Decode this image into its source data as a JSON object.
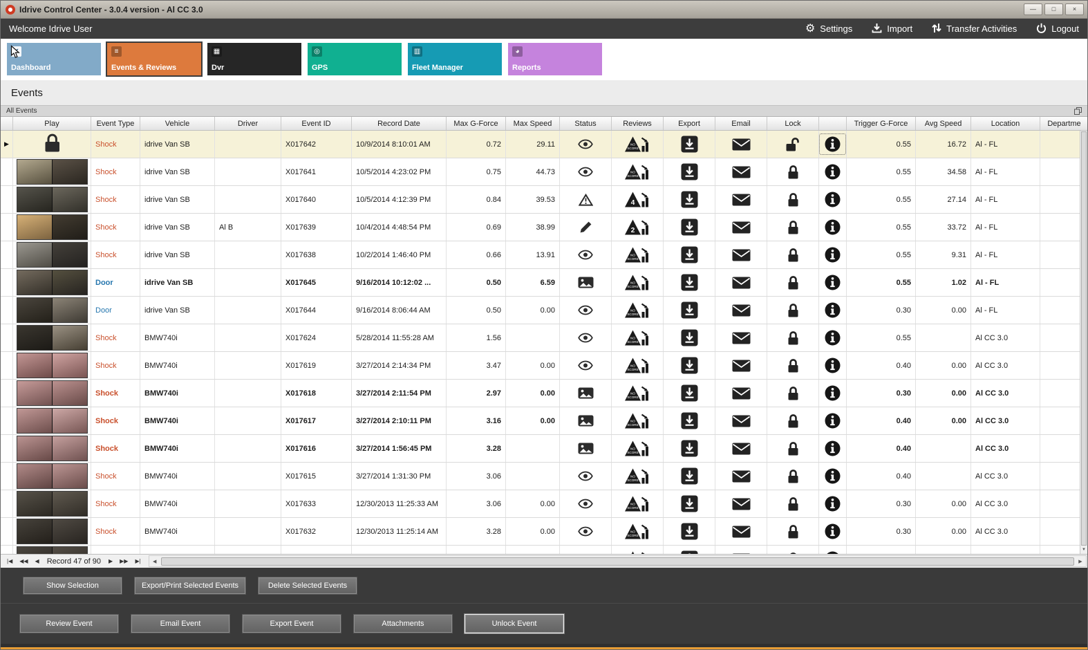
{
  "window": {
    "title": "Idrive Control Center - 3.0.4 version - Al CC 3.0",
    "controls": {
      "minimize": "—",
      "maximize": "□",
      "close": "×"
    }
  },
  "toolbar": {
    "welcome": "Welcome Idrive User",
    "actions": [
      {
        "label": "Settings",
        "icon": "gear-icon"
      },
      {
        "label": "Import",
        "icon": "import-icon"
      },
      {
        "label": "Transfer Activities",
        "icon": "transfer-icon"
      },
      {
        "label": "Logout",
        "icon": "power-icon"
      }
    ]
  },
  "tabs": [
    {
      "label": "Dashboard",
      "color": "#82aac8",
      "icon": "checkbox-icon",
      "selected": false
    },
    {
      "label": "Events & Reviews",
      "color": "#dd7a3d",
      "icon": "events-icon",
      "selected": true
    },
    {
      "label": "Dvr",
      "color": "#262626",
      "icon": "dvr-icon",
      "selected": false
    },
    {
      "label": "GPS",
      "color": "#10b091",
      "icon": "pin-icon",
      "selected": false
    },
    {
      "label": "Fleet Manager",
      "color": "#169bb4",
      "icon": "fleet-icon",
      "selected": false
    },
    {
      "label": "Reports",
      "color": "#c583dd",
      "icon": "pie-icon",
      "selected": false
    }
  ],
  "page": {
    "title": "Events",
    "group_header": "All Events"
  },
  "grid": {
    "selection_arrow": "▶",
    "columns": [
      "",
      "Play",
      "Event Type",
      "Vehicle",
      "Driver",
      "Event ID",
      "Record Date",
      "Max G-Force",
      "Max Speed",
      "Status",
      "Reviews",
      "Export",
      "Email",
      "Lock",
      "",
      "Trigger G-Force",
      "Avg Speed",
      "Location",
      "Departme"
    ],
    "rows": [
      {
        "selected": true,
        "bold": false,
        "play": "lock",
        "event_type": "Shock",
        "vehicle": "idrive Van SB",
        "driver": "",
        "event_id": "X017642",
        "record_date": "10/9/2014 8:10:01 AM",
        "max_g_force": "0.72",
        "max_speed": "29.11",
        "status": "eye",
        "review": "NO SCORE",
        "lock": "unlocked",
        "trigger_g_force": "0.55",
        "avg_speed": "16.72",
        "location": "Al - FL",
        "thumb": []
      },
      {
        "selected": false,
        "bold": false,
        "play": "thumb",
        "event_type": "Shock",
        "vehicle": "idrive Van SB",
        "driver": "",
        "event_id": "X017641",
        "record_date": "10/5/2014 4:23:02 PM",
        "max_g_force": "0.75",
        "max_speed": "44.73",
        "status": "eye",
        "review": "NO SCORE",
        "lock": "locked",
        "trigger_g_force": "0.55",
        "avg_speed": "34.58",
        "location": "Al - FL",
        "thumb": [
          "#b3a98f",
          "#57503f",
          "#5a5146",
          "#2a2620"
        ]
      },
      {
        "selected": false,
        "bold": false,
        "play": "thumb",
        "event_type": "Shock",
        "vehicle": "idrive Van SB",
        "driver": "",
        "event_id": "X017640",
        "record_date": "10/5/2014 4:12:39 PM",
        "max_g_force": "0.84",
        "max_speed": "39.53",
        "status": "warning",
        "review": "4",
        "lock": "locked",
        "trigger_g_force": "0.55",
        "avg_speed": "27.14",
        "location": "Al - FL",
        "thumb": [
          "#55534b",
          "#26251f",
          "#6b675c",
          "#32302a"
        ]
      },
      {
        "selected": false,
        "bold": false,
        "play": "thumb",
        "event_type": "Shock",
        "vehicle": "idrive Van SB",
        "driver": "Al B",
        "event_id": "X017639",
        "record_date": "10/4/2014 4:48:54 PM",
        "max_g_force": "0.69",
        "max_speed": "38.99",
        "status": "pencil",
        "review": "2",
        "lock": "locked",
        "trigger_g_force": "0.55",
        "avg_speed": "33.72",
        "location": "Al - FL",
        "thumb": [
          "#d7b177",
          "#7c6340",
          "#433c31",
          "#201d18"
        ]
      },
      {
        "selected": false,
        "bold": false,
        "play": "thumb",
        "event_type": "Shock",
        "vehicle": "idrive Van SB",
        "driver": "",
        "event_id": "X017638",
        "record_date": "10/2/2014 1:46:40 PM",
        "max_g_force": "0.66",
        "max_speed": "13.91",
        "status": "eye",
        "review": "NO SCORE",
        "lock": "locked",
        "trigger_g_force": "0.55",
        "avg_speed": "9.31",
        "location": "Al - FL",
        "thumb": [
          "#9b9890",
          "#4f4c45",
          "#44403a",
          "#242220"
        ]
      },
      {
        "selected": false,
        "bold": true,
        "play": "thumb",
        "event_type": "Door",
        "vehicle": "idrive Van SB",
        "driver": "",
        "event_id": "X017645",
        "record_date": "9/16/2014 10:12:02 ...",
        "max_g_force": "0.50",
        "max_speed": "6.59",
        "status": "image",
        "review": "NO SCORE",
        "lock": "locked",
        "trigger_g_force": "0.55",
        "avg_speed": "1.02",
        "location": "Al - FL",
        "thumb": [
          "#746b5e",
          "#332f28",
          "#55503f",
          "#262320"
        ]
      },
      {
        "selected": false,
        "bold": false,
        "play": "thumb",
        "event_type": "Door",
        "vehicle": "idrive Van SB",
        "driver": "",
        "event_id": "X017644",
        "record_date": "9/16/2014 8:06:44 AM",
        "max_g_force": "0.50",
        "max_speed": "0.00",
        "status": "eye",
        "review": "NO SCORE",
        "lock": "locked",
        "trigger_g_force": "0.30",
        "avg_speed": "0.00",
        "location": "Al - FL",
        "thumb": [
          "#4a453d",
          "#232019",
          "#8c8477",
          "#3e3a33"
        ]
      },
      {
        "selected": false,
        "bold": false,
        "play": "thumb",
        "event_type": "Shock",
        "vehicle": "BMW740i",
        "driver": "",
        "event_id": "X017624",
        "record_date": "5/28/2014 11:55:28 AM",
        "max_g_force": "1.56",
        "max_speed": "",
        "status": "eye",
        "review": "NO SCORE",
        "lock": "locked",
        "trigger_g_force": "0.55",
        "avg_speed": "",
        "location": "Al CC 3.0",
        "thumb": [
          "#3a362f",
          "#1c1a16",
          "#9a9183",
          "#463f33"
        ]
      },
      {
        "selected": false,
        "bold": false,
        "play": "thumb",
        "event_type": "Shock",
        "vehicle": "BMW740i",
        "driver": "",
        "event_id": "X017619",
        "record_date": "3/27/2014 2:14:34 PM",
        "max_g_force": "3.47",
        "max_speed": "0.00",
        "status": "eye",
        "review": "NO SCORE",
        "lock": "locked",
        "trigger_g_force": "0.40",
        "avg_speed": "0.00",
        "location": "Al CC 3.0",
        "thumb": [
          "#c49795",
          "#6e4b49",
          "#d0a4a2",
          "#7a5553"
        ]
      },
      {
        "selected": false,
        "bold": true,
        "play": "thumb",
        "event_type": "Shock",
        "vehicle": "BMW740i",
        "driver": "",
        "event_id": "X017618",
        "record_date": "3/27/2014 2:11:54 PM",
        "max_g_force": "2.97",
        "max_speed": "0.00",
        "status": "image",
        "review": "NO SCORE",
        "lock": "locked",
        "trigger_g_force": "0.30",
        "avg_speed": "0.00",
        "location": "Al CC 3.0",
        "thumb": [
          "#c79c9a",
          "#715150",
          "#bb918f",
          "#684a48"
        ]
      },
      {
        "selected": false,
        "bold": true,
        "play": "thumb",
        "event_type": "Shock",
        "vehicle": "BMW740i",
        "driver": "",
        "event_id": "X017617",
        "record_date": "3/27/2014 2:10:11 PM",
        "max_g_force": "3.16",
        "max_speed": "0.00",
        "status": "image",
        "review": "NO SCORE",
        "lock": "locked",
        "trigger_g_force": "0.40",
        "avg_speed": "0.00",
        "location": "Al CC 3.0",
        "thumb": [
          "#c19896",
          "#6d4e4c",
          "#cda8a6",
          "#775654"
        ]
      },
      {
        "selected": false,
        "bold": true,
        "play": "thumb",
        "event_type": "Shock",
        "vehicle": "BMW740i",
        "driver": "",
        "event_id": "X017616",
        "record_date": "3/27/2014 1:56:45 PM",
        "max_g_force": "3.28",
        "max_speed": "",
        "status": "image",
        "review": "NO SCORE",
        "lock": "locked",
        "trigger_g_force": "0.40",
        "avg_speed": "",
        "location": "Al CC 3.0",
        "thumb": [
          "#bb9492",
          "#674947",
          "#c5a09e",
          "#705251"
        ]
      },
      {
        "selected": false,
        "bold": false,
        "play": "thumb",
        "event_type": "Shock",
        "vehicle": "BMW740i",
        "driver": "",
        "event_id": "X017615",
        "record_date": "3/27/2014 1:31:30 PM",
        "max_g_force": "3.06",
        "max_speed": "",
        "status": "eye",
        "review": "NO SCORE",
        "lock": "locked",
        "trigger_g_force": "0.40",
        "avg_speed": "",
        "location": "Al CC 3.0",
        "thumb": [
          "#b28b89",
          "#5f4442",
          "#bc9694",
          "#6a4c4a"
        ]
      },
      {
        "selected": false,
        "bold": false,
        "play": "thumb",
        "event_type": "Shock",
        "vehicle": "BMW740i",
        "driver": "",
        "event_id": "X017633",
        "record_date": "12/30/2013 11:25:33 AM",
        "max_g_force": "3.06",
        "max_speed": "0.00",
        "status": "eye",
        "review": "NO SCORE",
        "lock": "locked",
        "trigger_g_force": "0.30",
        "avg_speed": "0.00",
        "location": "Al CC 3.0",
        "thumb": [
          "#565148",
          "#2b2822",
          "#5f594f",
          "#312d27"
        ]
      },
      {
        "selected": false,
        "bold": false,
        "play": "thumb",
        "event_type": "Shock",
        "vehicle": "BMW740i",
        "driver": "",
        "event_id": "X017632",
        "record_date": "12/30/2013 11:25:14 AM",
        "max_g_force": "3.28",
        "max_speed": "0.00",
        "status": "eye",
        "review": "NO SCORE",
        "lock": "locked",
        "trigger_g_force": "0.30",
        "avg_speed": "0.00",
        "location": "Al CC 3.0",
        "thumb": [
          "#46423b",
          "#231f1a",
          "#4f4a43",
          "#282420"
        ]
      },
      {
        "selected": false,
        "bold": false,
        "play": "thumb",
        "event_type": "",
        "vehicle": "",
        "driver": "",
        "event_id": "",
        "record_date": "",
        "max_g_force": "",
        "max_speed": "",
        "status": "eye",
        "review": "NO SCORE",
        "lock": "locked",
        "trigger_g_force": "",
        "avg_speed": "",
        "location": "",
        "thumb": [
          "#4b463f",
          "#262320",
          "#544e46",
          "#2b2722"
        ]
      }
    ]
  },
  "pager": {
    "record_text": "Record 47 of 90",
    "icons": {
      "first": "|◀",
      "prev_page": "◀◀",
      "prev": "◀",
      "next": "▶",
      "next_page": "▶▶",
      "last": "▶|"
    }
  },
  "footer": {
    "selection_buttons": [
      "Show Selection",
      "Export/Print Selected Events",
      "Delete Selected Events"
    ],
    "event_buttons": [
      "Review Event",
      "Email Event",
      "Export Event",
      "Attachments",
      "Unlock Event"
    ],
    "focused_button": "Unlock Event"
  },
  "colors": {
    "shock_text": "#c9502c",
    "door_text": "#2576ae",
    "selected_row": "#f6f2d8",
    "accent": "#dd7a3d",
    "bottom_bar": "#eda33a"
  }
}
